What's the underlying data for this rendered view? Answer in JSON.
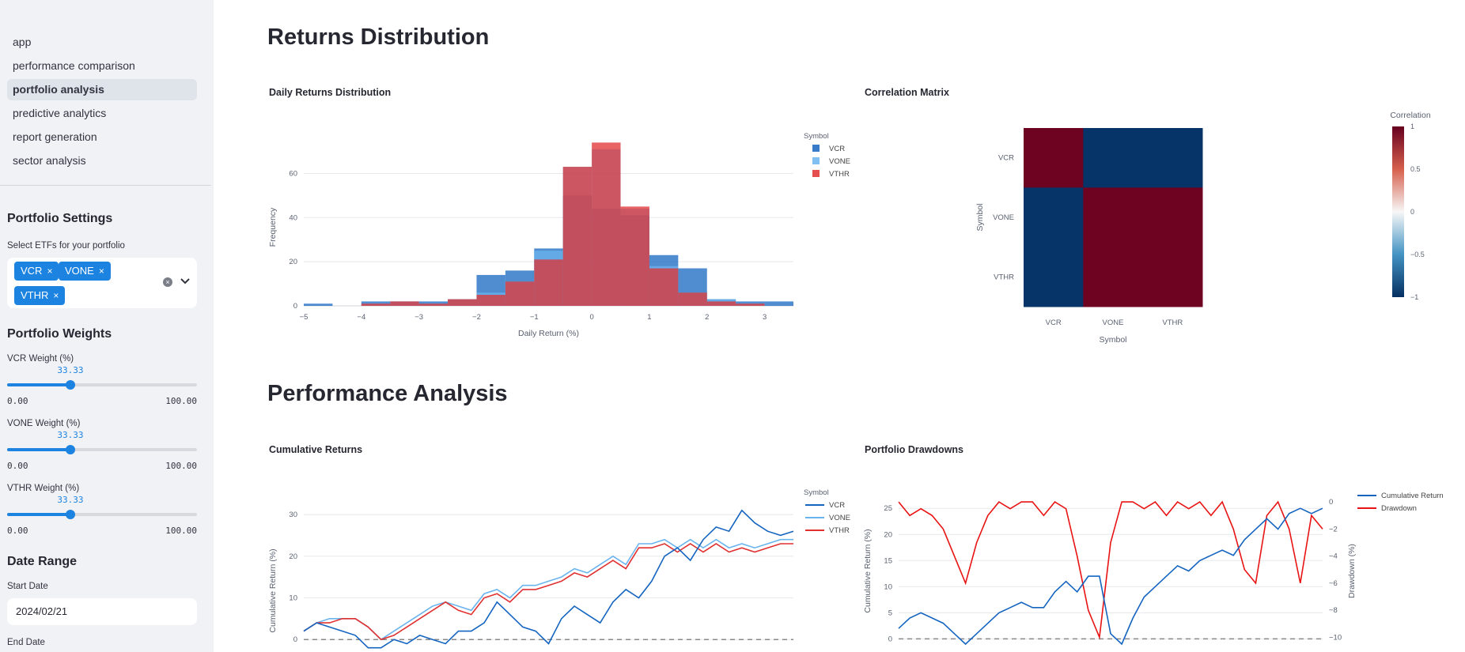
{
  "sidebar": {
    "nav": [
      {
        "label": "app",
        "active": false
      },
      {
        "label": "performance comparison",
        "active": false
      },
      {
        "label": "portfolio analysis",
        "active": true
      },
      {
        "label": "predictive analytics",
        "active": false
      },
      {
        "label": "report generation",
        "active": false
      },
      {
        "label": "sector analysis",
        "active": false
      }
    ],
    "portfolio_settings": {
      "title": "Portfolio Settings",
      "etf_label": "Select ETFs for your portfolio",
      "selected": [
        "VCR",
        "VONE",
        "VTHR"
      ],
      "remove_glyph": "×",
      "clear_glyph": "×"
    },
    "weights": {
      "title": "Portfolio Weights",
      "sliders": [
        {
          "label": "VCR Weight (%)",
          "value": "33.33",
          "fraction": 0.3333,
          "min": "0.00",
          "max": "100.00"
        },
        {
          "label": "VONE Weight (%)",
          "value": "33.33",
          "fraction": 0.3333,
          "min": "0.00",
          "max": "100.00"
        },
        {
          "label": "VTHR Weight (%)",
          "value": "33.33",
          "fraction": 0.3333,
          "min": "0.00",
          "max": "100.00"
        }
      ]
    },
    "date_range": {
      "title": "Date Range",
      "start_label": "Start Date",
      "start_value": "2024/02/21",
      "end_label": "End Date"
    }
  },
  "main": {
    "section1_title": "Returns Distribution",
    "section2_title": "Performance Analysis"
  },
  "colors": {
    "VCR": "#1565c0",
    "VONE": "#6ab4ee",
    "VTHR": "#e03030",
    "accent": "#1c83e1"
  },
  "chart_data": [
    {
      "type": "bar",
      "title": "Daily Returns Distribution",
      "xlabel": "Daily Return (%)",
      "ylabel": "Frequency",
      "legend_title": "Symbol",
      "legend_position": "top-right",
      "xlim": [
        -5,
        3.5
      ],
      "ylim": [
        0,
        77
      ],
      "xticks": [
        "−5",
        "−4",
        "−3",
        "−2",
        "−1",
        "0",
        "1",
        "2",
        "3"
      ],
      "yticks": [
        "0",
        "20",
        "40",
        "60"
      ],
      "bin_edges": [
        -5,
        -4.5,
        -4,
        -3.5,
        -3,
        -2.5,
        -2,
        -1.5,
        -1,
        -0.5,
        0,
        0.5,
        1,
        1.5,
        2,
        2.5,
        3,
        3.5
      ],
      "series": [
        {
          "name": "VCR",
          "values": [
            1,
            0,
            2,
            2,
            2,
            3,
            14,
            16,
            26,
            50,
            44,
            41,
            23,
            17,
            3,
            2,
            2
          ]
        },
        {
          "name": "VONE",
          "values": [
            0,
            0,
            1,
            2,
            1,
            3,
            6,
            11,
            25,
            63,
            71,
            44,
            18,
            6,
            3,
            1,
            0
          ]
        },
        {
          "name": "VTHR",
          "values": [
            0,
            0,
            1,
            2,
            1,
            3,
            5,
            11,
            21,
            63,
            74,
            45,
            17,
            6,
            2,
            1,
            0
          ]
        }
      ]
    },
    {
      "type": "heatmap",
      "title": "Correlation Matrix",
      "xlabel": "Symbol",
      "ylabel": "Symbol",
      "x": [
        "VCR",
        "VONE",
        "VTHR"
      ],
      "y": [
        "VCR",
        "VONE",
        "VTHR"
      ],
      "z": [
        [
          1,
          -1,
          -1
        ],
        [
          -1,
          1,
          1
        ],
        [
          -1,
          1,
          1
        ]
      ],
      "colorbar_title": "Correlation",
      "colorbar_ticks": [
        "1",
        "0.5",
        "0",
        "−0.5",
        "−1"
      ],
      "zlim": [
        -1,
        1
      ]
    },
    {
      "type": "line",
      "title": "Cumulative Returns",
      "ylabel": "Cumulative Return (%)",
      "legend_title": "Symbol",
      "legend_position": "top-right",
      "ylim": [
        -3,
        34
      ],
      "yticks": [
        "0",
        "10",
        "20",
        "30"
      ],
      "series": [
        {
          "name": "VCR",
          "values": [
            2,
            4,
            3,
            2,
            1,
            -2,
            -2,
            0,
            -1,
            1,
            0,
            -1,
            2,
            2,
            4,
            9,
            6,
            3,
            2,
            -1,
            5,
            8,
            6,
            4,
            9,
            12,
            10,
            14,
            20,
            22,
            19,
            24,
            27,
            26,
            31,
            28,
            26,
            25,
            26
          ]
        },
        {
          "name": "VONE",
          "values": [
            2,
            4,
            5,
            5,
            5,
            3,
            0,
            2,
            4,
            6,
            8,
            9,
            8,
            7,
            11,
            12,
            10,
            13,
            13,
            14,
            15,
            17,
            16,
            18,
            20,
            18,
            23,
            23,
            24,
            22,
            24,
            22,
            24,
            22,
            23,
            22,
            23,
            24,
            24
          ]
        },
        {
          "name": "VTHR",
          "values": [
            2,
            4,
            4,
            5,
            5,
            3,
            0,
            1,
            3,
            5,
            7,
            9,
            7,
            6,
            10,
            11,
            9,
            12,
            12,
            13,
            14,
            16,
            15,
            17,
            19,
            17,
            22,
            22,
            23,
            21,
            23,
            21,
            23,
            21,
            22,
            21,
            22,
            23,
            23
          ]
        }
      ],
      "baseline": 0
    },
    {
      "type": "line",
      "title": "Portfolio Drawdowns",
      "ylabel": "Cumulative Return (%)",
      "y2label": "Drawdown (%)",
      "legend_position": "top-right",
      "ylim": [
        -1,
        27
      ],
      "y2lim": [
        -10.5,
        0.3
      ],
      "yticks": [
        "0",
        "5",
        "10",
        "15",
        "20",
        "25"
      ],
      "y2ticks": [
        "0",
        "−2",
        "−4",
        "−6",
        "−8",
        "−10"
      ],
      "series": [
        {
          "name": "Cumulative Return",
          "axis": "y",
          "values": [
            2,
            4,
            5,
            4,
            3,
            1,
            -1,
            1,
            3,
            5,
            6,
            7,
            6,
            6,
            9,
            11,
            9,
            12,
            12,
            1,
            -1,
            4,
            8,
            10,
            12,
            14,
            13,
            15,
            16,
            17,
            16,
            19,
            21,
            23,
            21,
            24,
            25,
            24,
            25
          ]
        },
        {
          "name": "Drawdown",
          "axis": "y2",
          "values": [
            0,
            -1,
            -0.5,
            -1,
            -2,
            -4,
            -6,
            -3,
            -1,
            0,
            -0.5,
            0,
            0,
            -1,
            0,
            -0.5,
            -4,
            -8,
            -10,
            -3,
            0,
            0,
            -0.5,
            0,
            -1,
            0,
            -0.5,
            0,
            -1,
            0,
            -2,
            -5,
            -6,
            -1,
            0,
            -2,
            -6,
            -1,
            -2
          ]
        }
      ],
      "baseline": 0
    }
  ]
}
